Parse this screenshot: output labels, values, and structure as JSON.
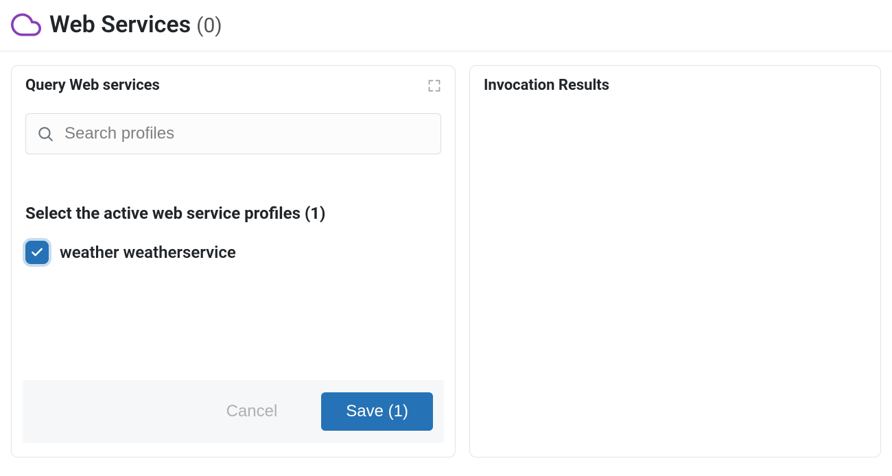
{
  "header": {
    "title": "Web Services",
    "count_display": "(0)"
  },
  "left_panel": {
    "title": "Query Web services",
    "search_placeholder": "Search profiles",
    "section_title": "Select the active web service profiles (1)",
    "profiles": [
      {
        "label": "weather weatherservice",
        "checked": true
      }
    ],
    "cancel_label": "Cancel",
    "save_label": "Save (1)"
  },
  "right_panel": {
    "title": "Invocation Results"
  }
}
